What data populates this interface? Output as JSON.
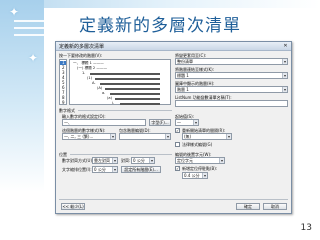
{
  "slide": {
    "title": "定義新的多層次清單",
    "page_number": "13"
  },
  "dialog": {
    "title": "定義新的多層次清單",
    "close_glyph": "✕",
    "level_click_label": "按一下要修改的階層(V):",
    "levels": [
      "1",
      "2",
      "3",
      "4",
      "5",
      "6",
      "7",
      "8",
      "9"
    ],
    "preview": [
      {
        "num": "一、",
        "text": "標題 1 ———"
      },
      {
        "num": "(一)",
        "text": "標題 2 ———"
      },
      {
        "num": "1.",
        "text": ""
      },
      {
        "num": "(1)",
        "text": ""
      },
      {
        "num": "A.",
        "text": ""
      },
      {
        "num": "(A)",
        "text": ""
      },
      {
        "num": "a.",
        "text": ""
      },
      {
        "num": "(a)",
        "text": ""
      },
      {
        "num": "i.",
        "text": ""
      }
    ],
    "apply_label": "將變更套用至(C):",
    "apply_value": "整份清單",
    "link_style_label": "將階層連結至樣式(K):",
    "link_style_value": "標題 1",
    "gallery_level_label": "圖庫中顯示的階層(H):",
    "gallery_level_value": "階層 1",
    "listnum_label": "ListNum 功能變數清單名稱(T):",
    "number_format_group": "數字格式",
    "number_format_label": "輸入數字的格式設定(O):",
    "number_format_value": "一、",
    "font_button": "字型(F)...",
    "start_at_label": "起始值(S):",
    "start_at_value": "一",
    "restart_label": "重新開始清單的間隔(R):",
    "restart_value": "(無)",
    "number_style_label": "這個階層的數字樣式(N):",
    "number_style_value": "一, 二, 三 (繁)...",
    "include_level_label": "包含階層編號(D):",
    "legal_label": "法律樣式編號(G)",
    "position_group": "位置",
    "alignment_label": "數字對齊方式(U):",
    "alignment_value": "靠左對齊",
    "aligned_at_label": "對齊:",
    "aligned_at_value": "0 公分",
    "text_indent_label": "文字縮排位置(I):",
    "text_indent_value": "0 公分",
    "set_all_button": "設定所有階層(E)...",
    "follow_label": "編號的後置字元(W):",
    "follow_value": "定位字元",
    "add_tab_label": "新增定位停駐點(B):",
    "add_tab_value": "0.4 公分",
    "less_button": "<< 較少(L)",
    "ok_button": "確定",
    "cancel_button": "取消",
    "dropdown_glyph": "▾",
    "check_glyph": "✓"
  },
  "colors": {
    "title": "#1f5f99",
    "selection": "#3b79c3",
    "dialog_bg": "#f0f0f0"
  }
}
